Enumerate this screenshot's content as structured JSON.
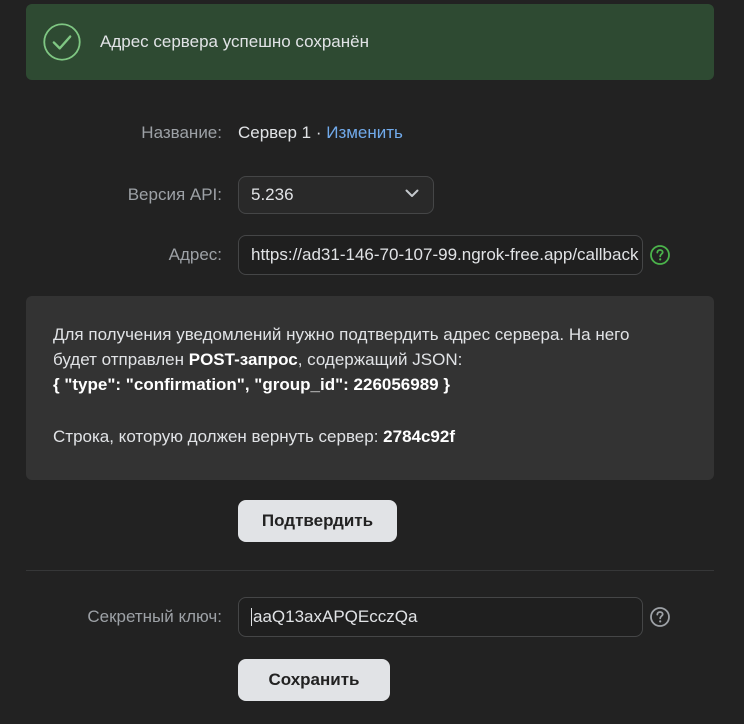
{
  "success": {
    "message": "Адрес сервера успешно сохранён",
    "icon": "check-circle-icon"
  },
  "form": {
    "name": {
      "label": "Название:",
      "value": "Сервер 1",
      "separator": " · ",
      "edit_link": "Изменить"
    },
    "api_version": {
      "label": "Версия API:",
      "selected": "5.236"
    },
    "address": {
      "label": "Адрес:",
      "value": "https://ad31-146-70-107-99.ngrok-free.app/callback"
    },
    "secret": {
      "label": "Секретный ключ:",
      "value": "aaQ13axAPQEcczQa"
    }
  },
  "info": {
    "line1": "Для получения уведомлений нужно подтвердить адрес сервера. На него",
    "line2_prefix": "будет отправлен ",
    "line2_bold": "POST-запрос",
    "line2_suffix": ", содержащий JSON:",
    "json": "{ \"type\": \"confirmation\", \"group_id\": 226056989 }",
    "line4_prefix": "Строка, которую должен вернуть сервер: ",
    "line4_code": "2784c92f"
  },
  "buttons": {
    "confirm": "Подтвердить",
    "save": "Сохранить"
  },
  "colors": {
    "success_bg": "#2e4a32",
    "success_accent": "#7fc783",
    "link": "#71aaeb",
    "background": "#222222"
  }
}
